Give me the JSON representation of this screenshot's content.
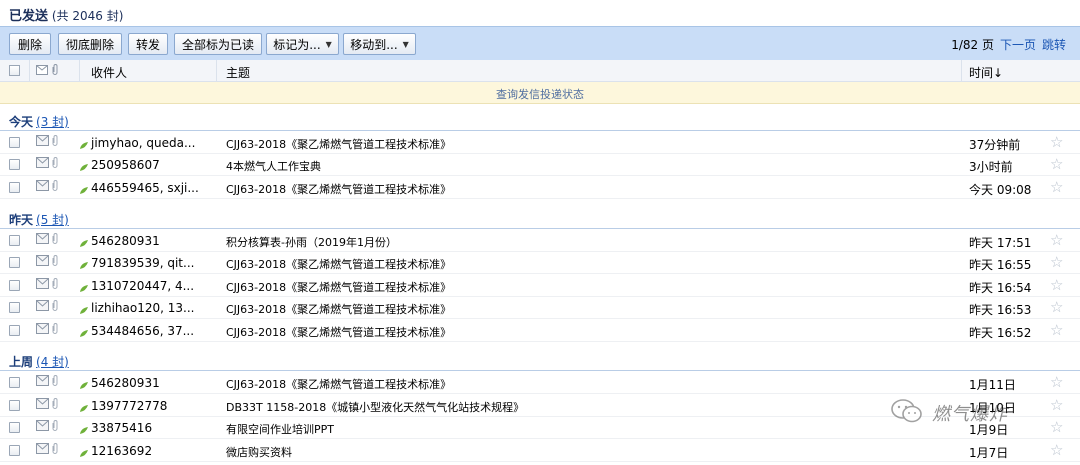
{
  "header": {
    "title": "已发送",
    "count_text": "(共 2046 封)"
  },
  "toolbar": {
    "delete": "删除",
    "delete_permanent": "彻底删除",
    "forward": "转发",
    "mark_all_read": "全部标为已读",
    "mark_as": "标记为...",
    "move_to": "移动到...",
    "page_info": "1/82 页",
    "next_page": "下一页",
    "jump": "跳转"
  },
  "columns": {
    "recipient": "收件人",
    "subject": "主题",
    "time": "时间↓"
  },
  "notice": "查询发信投递状态",
  "groups": [
    {
      "name": "今天",
      "count": "(3 封)",
      "rows": [
        {
          "recipient": "jimyhao, queda...",
          "subject": "CJJ63-2018《聚乙烯燃气管道工程技术标准》",
          "time": "37分钟前"
        },
        {
          "recipient": "250958607",
          "subject": "4本燃气人工作宝典",
          "time": "3小时前"
        },
        {
          "recipient": "446559465, sxji...",
          "subject": "CJJ63-2018《聚乙烯燃气管道工程技术标准》",
          "time": "今天 09:08"
        }
      ]
    },
    {
      "name": "昨天",
      "count": "(5 封)",
      "rows": [
        {
          "recipient": "546280931",
          "subject": "积分核算表-孙雨（2019年1月份）",
          "time": "昨天 17:51"
        },
        {
          "recipient": "791839539, qit...",
          "subject": "CJJ63-2018《聚乙烯燃气管道工程技术标准》",
          "time": "昨天 16:55"
        },
        {
          "recipient": "1310720447, 4...",
          "subject": "CJJ63-2018《聚乙烯燃气管道工程技术标准》",
          "time": "昨天 16:54"
        },
        {
          "recipient": "lizhihao120, 13...",
          "subject": "CJJ63-2018《聚乙烯燃气管道工程技术标准》",
          "time": "昨天 16:53"
        },
        {
          "recipient": "534484656, 37...",
          "subject": "CJJ63-2018《聚乙烯燃气管道工程技术标准》",
          "time": "昨天 16:52"
        }
      ]
    },
    {
      "name": "上周",
      "count": "(4 封)",
      "rows": [
        {
          "recipient": "546280931",
          "subject": "CJJ63-2018《聚乙烯燃气管道工程技术标准》",
          "time": "1月11日"
        },
        {
          "recipient": "1397772778",
          "subject": "DB33T 1158-2018《城镇小型液化天然气气化站技术规程》",
          "time": "1月10日"
        },
        {
          "recipient": "33875416",
          "subject": "有限空间作业培训PPT",
          "time": "1月9日"
        },
        {
          "recipient": "12163692",
          "subject": "微店购买资料",
          "time": "1月7日"
        }
      ]
    }
  ],
  "watermark": {
    "text": "燃气爆炸"
  },
  "colors": {
    "toolbar_bg": "#c9ddf7",
    "group_text": "#1c3e7a",
    "link": "#1b56b4",
    "notice_bg": "#fdf7dc",
    "dot_green": "#6fb13a"
  },
  "icons": {
    "envelope": "envelope-icon",
    "attachment": "paperclip-icon",
    "star": "star-icon",
    "status": "green-dot-icon"
  }
}
